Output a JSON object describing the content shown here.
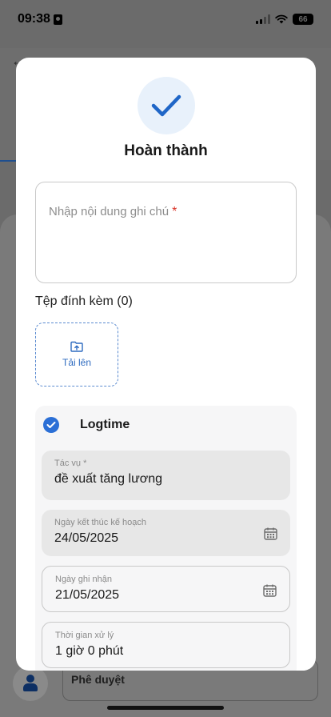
{
  "status_bar": {
    "time": "09:38",
    "battery": "66"
  },
  "modal": {
    "title": "Hoàn thành",
    "note": {
      "placeholder": "Nhập nội dung ghi chú",
      "required_mark": "*"
    },
    "attachments": {
      "label": "Tệp đính kèm (0)",
      "upload_label": "Tải lên"
    },
    "logtime": {
      "label": "Logtime",
      "checked": true,
      "fields": [
        {
          "label": "Tác vụ *",
          "value": "đề xuất tăng lương",
          "style": "filled",
          "icon": null
        },
        {
          "label": "Ngày kết thúc kế hoạch",
          "value": "24/05/2025",
          "style": "filled",
          "icon": "calendar-icon"
        },
        {
          "label": "Ngày ghi nhận",
          "value": "21/05/2025",
          "style": "outlined",
          "icon": "calendar-icon"
        },
        {
          "label": "Thời gian xử lý",
          "value": "1 giờ 0 phút",
          "style": "outlined",
          "icon": null
        }
      ]
    }
  },
  "background": {
    "approve_label": "Phê duyệt"
  },
  "colors": {
    "accent": "#2b6fd6",
    "required": "#d93025",
    "check_bg": "#e8f1fb"
  }
}
